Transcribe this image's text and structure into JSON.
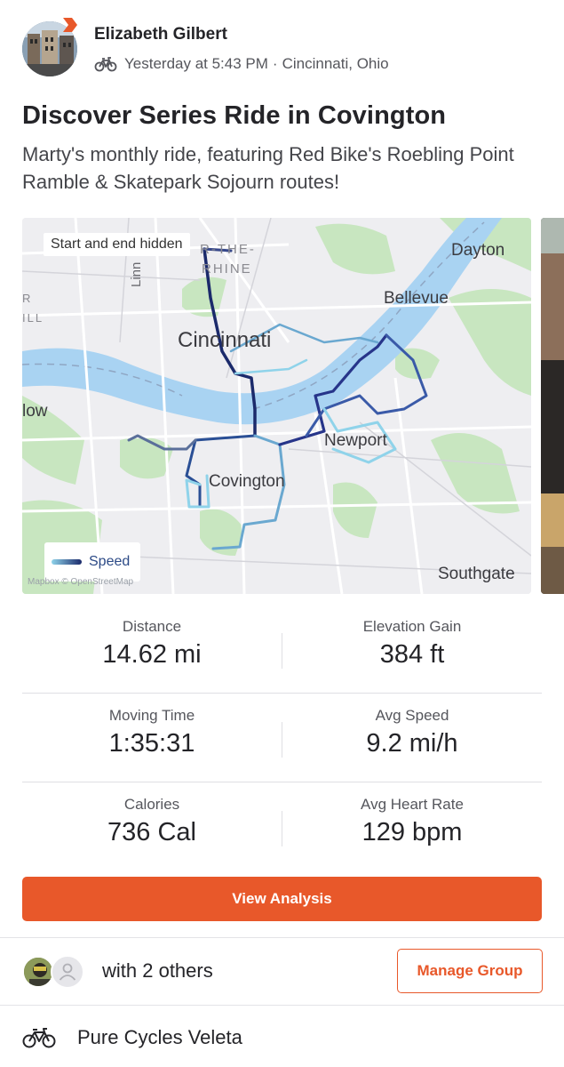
{
  "activity": {
    "athlete_name": "Elizabeth Gilbert",
    "sport_icon": "bike-icon",
    "time": "Yesterday at 5:43 PM",
    "separator": "·",
    "location": "Cincinnati, Ohio",
    "title": "Discover Series Ride in Covington",
    "description": "Marty's monthly ride, featuring Red Bike's Roebling Point Ramble & Skatepark Sojourn routes!"
  },
  "map": {
    "privacy_label": "Start and end hidden",
    "legend_label": "Speed",
    "attribution": "Mapbox © OpenStreetMap",
    "places": {
      "otr": "R-THE-",
      "otr2": "RHINE",
      "linn": "Linn",
      "cincinnati": "Cincinnati",
      "dayton": "Dayton",
      "bellevue": "Bellevue",
      "newport": "Newport",
      "covington": "Covington",
      "low": "low",
      "ill": "ILL",
      "r": "R",
      "southgate": "Southgate"
    },
    "colors": {
      "river": "#a9d3f2",
      "park": "#c8e6c0",
      "route_slow": "#8fd3ea",
      "route_fast": "#1b2a6b"
    }
  },
  "stats": [
    {
      "left": {
        "label": "Distance",
        "value": "14.62 mi"
      },
      "right": {
        "label": "Elevation Gain",
        "value": "384 ft"
      }
    },
    {
      "left": {
        "label": "Moving Time",
        "value": "1:35:31"
      },
      "right": {
        "label": "Avg Speed",
        "value": "9.2 mi/h"
      }
    },
    {
      "left": {
        "label": "Calories",
        "value": "736 Cal"
      },
      "right": {
        "label": "Avg Heart Rate",
        "value": "129 bpm"
      }
    }
  ],
  "actions": {
    "view_analysis": "View Analysis",
    "group_text": "with 2 others",
    "manage_group": "Manage Group"
  },
  "gear": {
    "name": "Pure Cycles Veleta"
  },
  "colors": {
    "accent": "#e8582a",
    "text": "#242428",
    "muted": "#55565c"
  }
}
